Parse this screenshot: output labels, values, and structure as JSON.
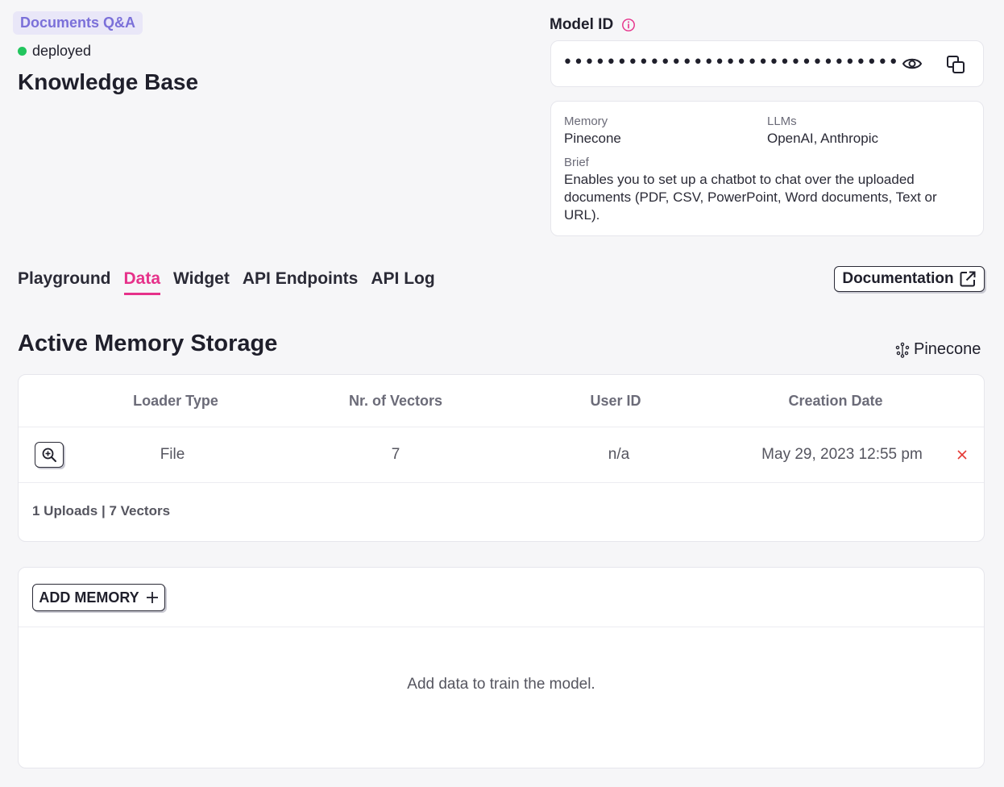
{
  "header": {
    "project_tag": "Documents Q&A",
    "status": "deployed",
    "title": "Knowledge Base"
  },
  "model": {
    "label": "Model ID",
    "masked_value": "•••••••••••••••••••••••••••••••"
  },
  "info": {
    "memory_label": "Memory",
    "memory_value": "Pinecone",
    "llms_label": "LLMs",
    "llms_value": "OpenAI, Anthropic",
    "brief_label": "Brief",
    "brief_value": "Enables you to set up a chatbot to chat over the uploaded documents (PDF, CSV, PowerPoint, Word documents, Text or URL)."
  },
  "tabs": [
    {
      "label": "Playground"
    },
    {
      "label": "Data"
    },
    {
      "label": "Widget"
    },
    {
      "label": "API Endpoints"
    },
    {
      "label": "API Log"
    }
  ],
  "documentation_label": "Documentation",
  "storage": {
    "title": "Active Memory Storage",
    "provider": "Pinecone",
    "columns": [
      "Loader Type",
      "Nr. of Vectors",
      "User ID",
      "Creation Date"
    ],
    "rows": [
      {
        "loader_type": "File",
        "vectors": "7",
        "user_id": "n/a",
        "created": "May 29, 2023 12:55 pm"
      }
    ],
    "summary": "1 Uploads | 7 Vectors"
  },
  "add_memory": {
    "button_label": "ADD MEMORY",
    "empty_message": "Add data to train the model."
  },
  "colors": {
    "accent": "#e6318a",
    "tag_text": "#7b70d9",
    "status_dot": "#22c55e",
    "delete": "#e53935"
  }
}
